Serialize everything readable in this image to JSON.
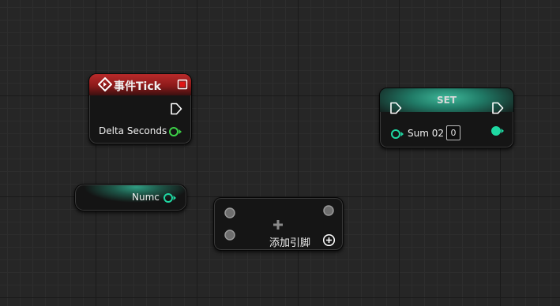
{
  "event_tick": {
    "title": "事件Tick",
    "output_label": "Delta Seconds"
  },
  "set_node": {
    "title": "SET",
    "variable_label": "Sum 02",
    "value": "0"
  },
  "getter_node": {
    "label": "Numc"
  },
  "add_node": {
    "add_pin_label": "添加引脚"
  },
  "colors": {
    "event_header": "#8c1a1a",
    "float_pin": "#3dd148",
    "int_pin": "#1fd8a2",
    "variable_header": "#208a74"
  }
}
